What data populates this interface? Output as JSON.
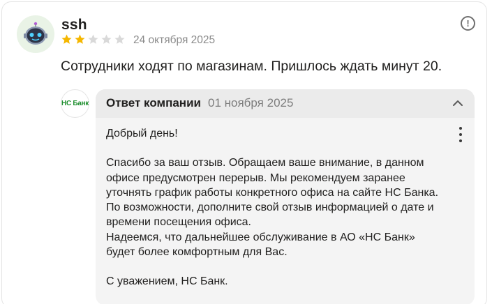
{
  "review": {
    "author": "ssh",
    "rating": 2,
    "max_rating": 5,
    "date": "24 октября 2025",
    "text": "Сотрудники ходят по магазинам. Пришлось ждать минут 20.",
    "info_icon": "exclamation-circle-icon"
  },
  "colors": {
    "star_filled": "#f5b700",
    "star_empty": "#d9d9d9",
    "avatar_bg": "#e9f3e6",
    "brand_green": "#1f8f2f"
  },
  "company": {
    "logo_text": "НС Банк"
  },
  "reply": {
    "title": "Ответ компании",
    "date": "01 ноября 2025",
    "greeting": "Добрый день!",
    "paragraph1": "Спасибо за ваш отзыв. Обращаем ваше внимание, в данном\nофисе предусмотрен перерыв. Мы рекомендуем заранее\nуточнять график работы конкретного офиса на сайте НС Банка.\nПо возможности, дополните свой отзыв информацией о дате и\nвремени посещения офиса.\nНадеемся, что дальнейшее обслуживание в АО «НС Банк»\nбудет более комфортным для Вас.",
    "signature": "С уважением, НС Банк."
  }
}
